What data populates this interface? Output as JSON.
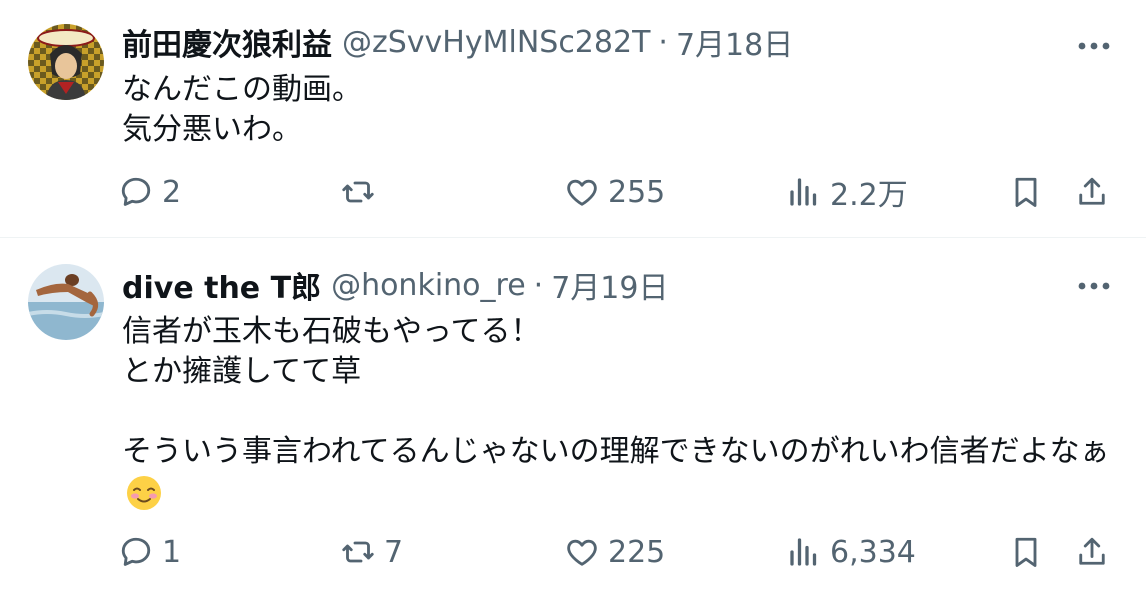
{
  "tweets": [
    {
      "avatar_icon": "samurai-portrait-avatar",
      "name": "前田慶次狼利益",
      "handle": "@zSvvHyMlNSc282T",
      "separator": "·",
      "date": "7月18日",
      "text": "なんだこの動画。\n気分悪いわ。",
      "emoji": "",
      "replies": "2",
      "retweets": "",
      "likes": "255",
      "views": "2.2万"
    },
    {
      "avatar_icon": "swimmer-photo-avatar",
      "name": "dive the T郎",
      "handle": "@honkino_re",
      "separator": "·",
      "date": "7月19日",
      "text": "信者が玉木も石破もやってる！\nとか擁護してて草\n\nそういう事言われてるんじゃないの理解できないのがれいわ信者だよなぁ",
      "emoji": "smiling-face-with-blush-emoji",
      "replies": "1",
      "retweets": "7",
      "likes": "225",
      "views": "6,334"
    }
  ],
  "colors": {
    "text": "#0f1419",
    "secondary": "#536471",
    "divider": "#eff3f4"
  }
}
